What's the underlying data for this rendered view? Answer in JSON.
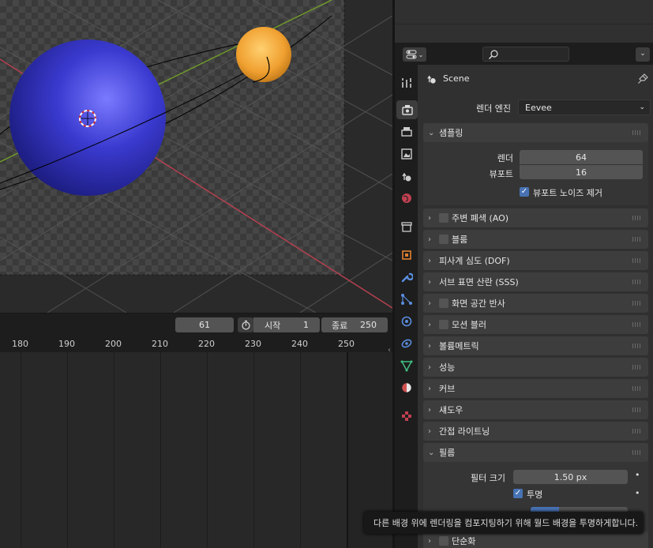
{
  "timeline": {
    "current_frame": "61",
    "start_label": "시작",
    "start_value": "1",
    "end_label": "종료",
    "end_value": "250",
    "ruler_ticks": [
      "180",
      "190",
      "200",
      "210",
      "220",
      "230",
      "240",
      "250"
    ]
  },
  "properties": {
    "scene_name": "Scene",
    "render_engine_label": "렌더 엔진",
    "render_engine_value": "Eevee",
    "sampling": {
      "title": "샘플링",
      "render_label": "렌더",
      "render_value": "64",
      "viewport_label": "뷰포트",
      "viewport_value": "16",
      "denoise_label": "뷰포트 노이즈 제거"
    },
    "panels": [
      {
        "label": "주변 폐색 (AO)",
        "checkbox": true
      },
      {
        "label": "블룸",
        "checkbox": true
      },
      {
        "label": "피사계 심도 (DOF)",
        "checkbox": false
      },
      {
        "label": "서브 표면 산란 (SSS)",
        "checkbox": false
      },
      {
        "label": "화면 공간 반사",
        "checkbox": true
      },
      {
        "label": "모션 블러",
        "checkbox": true
      },
      {
        "label": "볼륨메트릭",
        "checkbox": false
      },
      {
        "label": "성능",
        "checkbox": false
      },
      {
        "label": "커브",
        "checkbox": false
      },
      {
        "label": "섀도우",
        "checkbox": false
      },
      {
        "label": "간접 라이트닝",
        "checkbox": false
      }
    ],
    "film": {
      "title": "필름",
      "filter_size_label": "필터 크기",
      "filter_size_value": "1.50 px",
      "transparent_label": "투명"
    },
    "bottom_panel": "단순화"
  },
  "tooltip": "다른 배경 위에 렌더링을 컴포지팅하기 위해 월드 배경을 투명하게합니다.",
  "colors": {
    "accent": "#4772b3",
    "x_axis": "#b5404f",
    "y_axis": "#6f9a2a",
    "sphere_blue": "#3838c8",
    "sphere_orange": "#f0a030"
  }
}
